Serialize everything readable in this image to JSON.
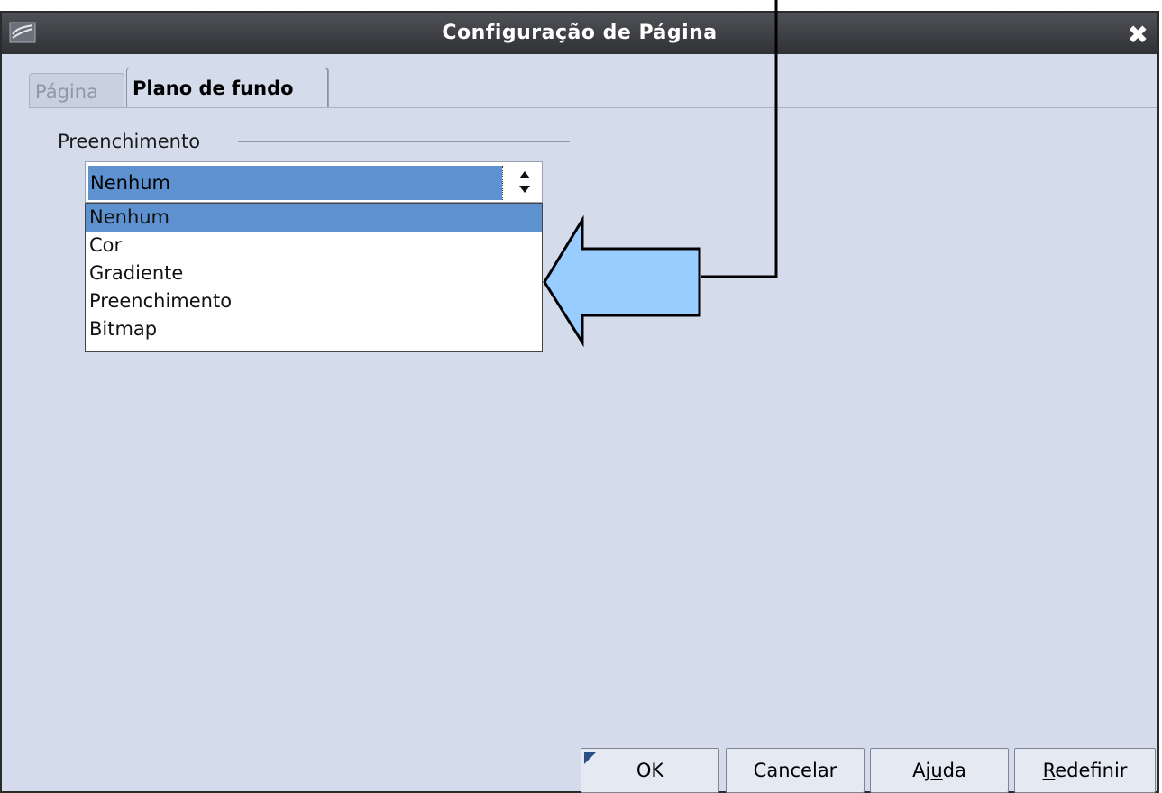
{
  "window": {
    "title": "Configuração de Página"
  },
  "tabs": [
    {
      "label": "Página",
      "active": false
    },
    {
      "label": "Plano de fundo",
      "active": true
    }
  ],
  "fill": {
    "group_label": "Preenchimento",
    "selected": "Nenhum",
    "options": [
      "Nenhum",
      "Cor",
      "Gradiente",
      "Preenchimento",
      "Bitmap"
    ]
  },
  "buttons": {
    "ok": "OK",
    "cancel": "Cancelar",
    "help_pre": "Aj",
    "help_u": "u",
    "help_post": "da",
    "reset_u": "R",
    "reset_post": "edefinir"
  },
  "colors": {
    "accent": "#5e91cf",
    "arrow_fill": "#99ccff",
    "dialog_bg": "#d4dcec"
  }
}
